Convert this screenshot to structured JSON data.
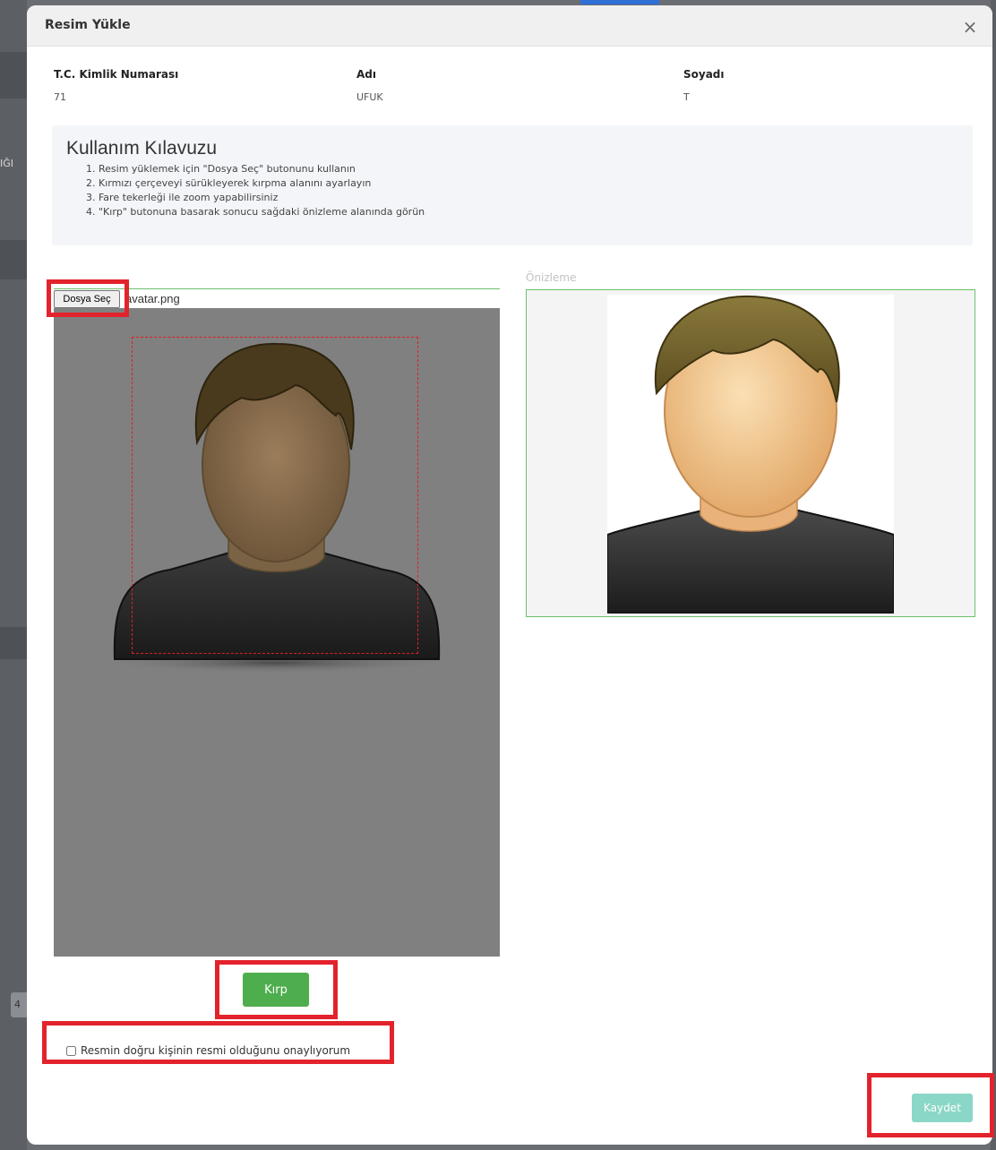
{
  "modal": {
    "title": "Resim Yükle",
    "close_icon": "close-icon",
    "close_glyph": "×"
  },
  "person": {
    "tc_label": "T.C. Kimlik Numarası",
    "tc_value": "71",
    "name_label": "Adı",
    "name_value": "UFUK",
    "surname_label": "Soyadı",
    "surname_value": "T"
  },
  "guide": {
    "title": "Kullanım Kılavuzu",
    "steps": [
      "1. Resim yüklemek için \"Dosya Seç\" butonunu kullanın",
      "2. Kırmızı çerçeveyi sürükleyerek kırpma alanını ayarlayın",
      "3. Fare tekerleği ile zoom yapabilirsiniz",
      "4. \"Kırp\" butonuna basarak sonucu sağdaki önizleme alanında görün"
    ]
  },
  "upload": {
    "file_button": "Dosya Seç",
    "file_name": "avatar.png"
  },
  "preview": {
    "label": "Önizleme"
  },
  "actions": {
    "crop_label": "Kırp",
    "confirm_label": "Resmin doğru kişinin resmi olduğunu onaylıyorum",
    "confirm_checked": false,
    "save_label": "Kaydet"
  },
  "colors": {
    "accent_green": "#4eae4e",
    "save_disabled": "#8ad7c7",
    "highlight_red": "#e3232c",
    "crop_frame": "#e02020"
  }
}
